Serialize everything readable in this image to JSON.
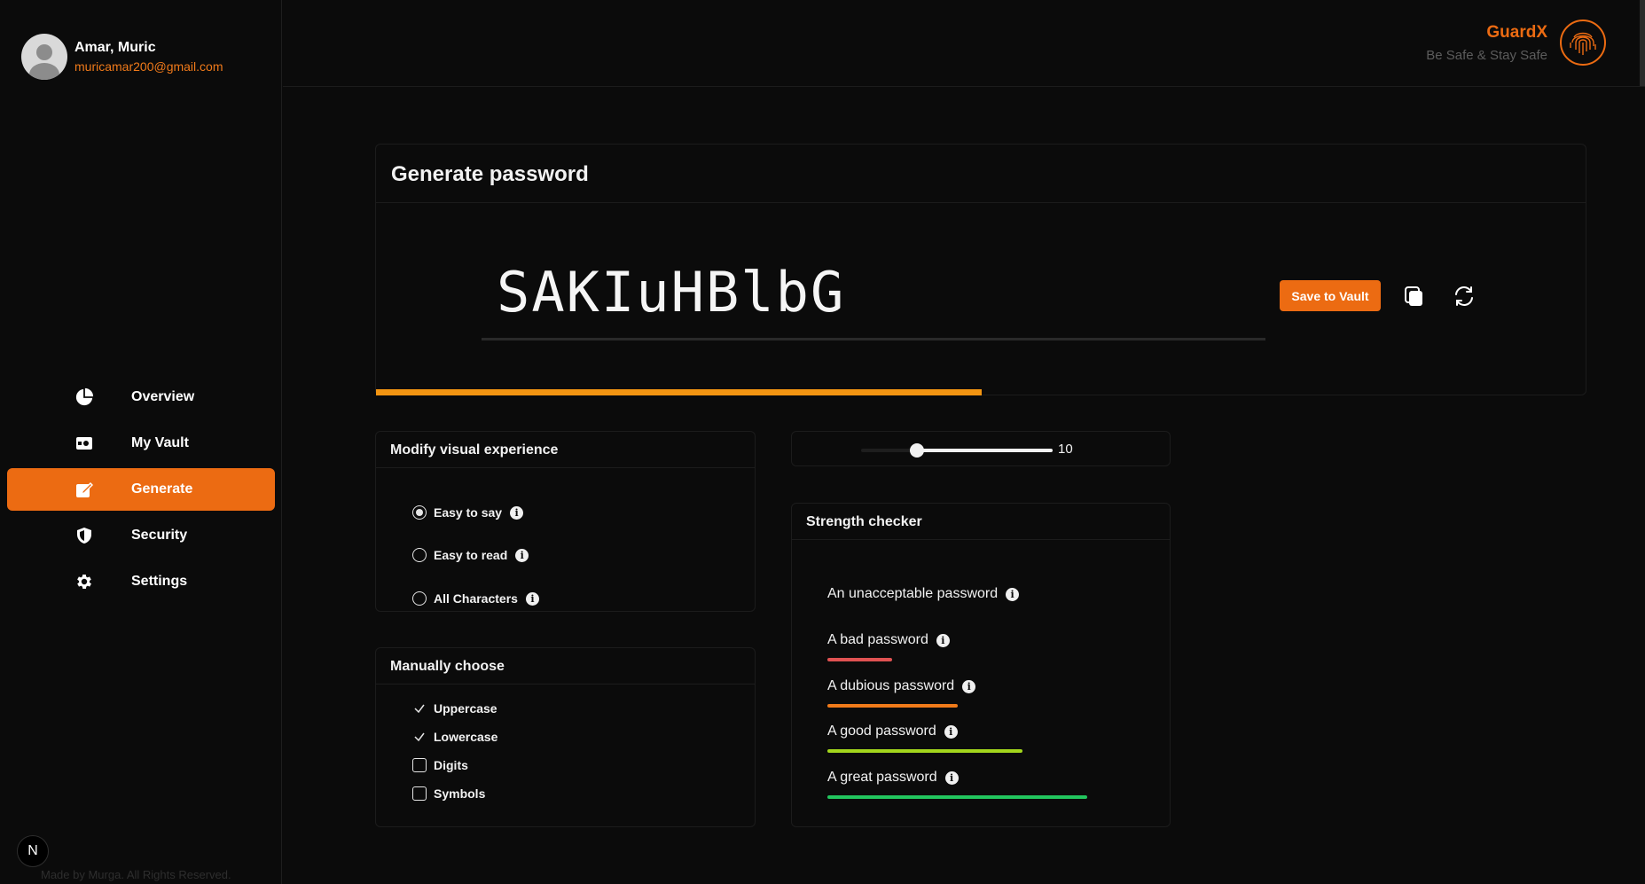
{
  "user": {
    "name": "Amar, Muric",
    "email": "muricamar200@gmail.com"
  },
  "nav": {
    "items": [
      {
        "label": "Overview",
        "icon": "pie-chart-icon"
      },
      {
        "label": "My Vault",
        "icon": "vault-icon"
      },
      {
        "label": "Generate",
        "icon": "edit-icon",
        "active": true
      },
      {
        "label": "Security",
        "icon": "shield-icon"
      },
      {
        "label": "Settings",
        "icon": "gear-icon"
      }
    ]
  },
  "footer": {
    "badge": "N",
    "note": "Made by Murga. All Rights Reserved."
  },
  "brand": {
    "name": "GuardX",
    "tagline": "Be Safe & Stay Safe",
    "logo": "fingerprint-icon"
  },
  "generate": {
    "title": "Generate password",
    "password": "SAKIuHBlbG",
    "save_label": "Save to Vault",
    "copy_icon": "copy-icon",
    "refresh_icon": "refresh-icon",
    "strength_fraction": 0.5
  },
  "visual": {
    "title": "Modify visual experience",
    "options": [
      {
        "label": "Easy to say",
        "checked": true
      },
      {
        "label": "Easy to read",
        "checked": false
      },
      {
        "label": "All Characters",
        "checked": false
      }
    ]
  },
  "manual": {
    "title": "Manually choose",
    "options": [
      {
        "label": "Uppercase",
        "checked": true
      },
      {
        "label": "Lowercase",
        "checked": true
      },
      {
        "label": "Digits",
        "checked": false
      },
      {
        "label": "Symbols",
        "checked": false
      }
    ]
  },
  "length": {
    "value": "10",
    "min": 0,
    "max": 34,
    "fraction": 0.29
  },
  "strength": {
    "title": "Strength checker",
    "levels": [
      {
        "label": "An unacceptable password",
        "color": "",
        "fraction": 0
      },
      {
        "label": "A bad password",
        "color": "#e05252",
        "fraction": 0.25
      },
      {
        "label": "A dubious password",
        "color": "#f07a1a",
        "fraction": 0.5
      },
      {
        "label": "A good password",
        "color": "#a3d61c",
        "fraction": 0.75
      },
      {
        "label": "A great password",
        "color": "#22c55e",
        "fraction": 1.0
      }
    ]
  },
  "colors": {
    "accent": "#ec6b12",
    "strength_bar": "#f39512",
    "background": "#0b0b0b"
  }
}
